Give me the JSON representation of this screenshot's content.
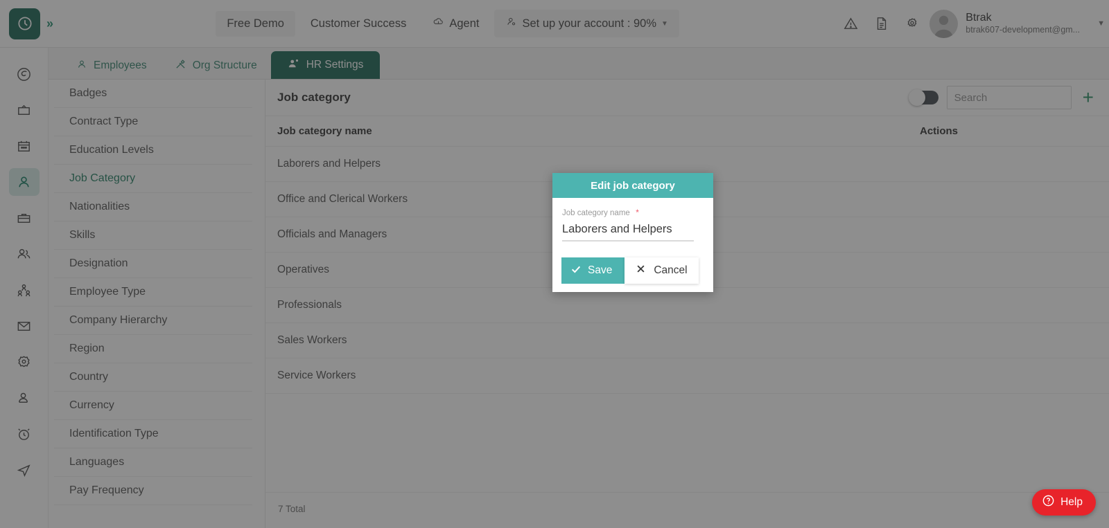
{
  "header": {
    "logo_icon": "clock-logo-icon",
    "expand_icon": "chevron-double-right-icon",
    "nav": [
      {
        "label": "Free Demo",
        "icon": null,
        "boxed": true
      },
      {
        "label": "Customer Success",
        "icon": null,
        "boxed": false
      },
      {
        "label": "Agent",
        "icon": "cloud-icon",
        "boxed": false
      },
      {
        "label": "Set up your account : 90%",
        "icon": "account-setup-icon",
        "boxed": true,
        "caret": true
      }
    ],
    "icons": [
      "warning-triangle-icon",
      "document-icon",
      "gear-icon"
    ],
    "user": {
      "name": "Btrak",
      "email": "btrak607-development@gm...",
      "avatar_icon": "avatar-icon",
      "caret": "chevron-down-icon"
    }
  },
  "rail": {
    "items": [
      {
        "name": "dashboard",
        "icon": "spiral-icon",
        "active": false
      },
      {
        "name": "projects",
        "icon": "tv-icon",
        "active": false
      },
      {
        "name": "calendar",
        "icon": "calendar-icon",
        "active": false
      },
      {
        "name": "employees",
        "icon": "person-icon",
        "active": true
      },
      {
        "name": "briefcase",
        "icon": "briefcase-icon",
        "active": false
      },
      {
        "name": "teams",
        "icon": "people-icon",
        "active": false
      },
      {
        "name": "org-chart",
        "icon": "org-chart-icon",
        "active": false
      },
      {
        "name": "mail",
        "icon": "envelope-icon",
        "active": false
      },
      {
        "name": "settings",
        "icon": "gear-flower-icon",
        "active": false
      },
      {
        "name": "profile",
        "icon": "user-badge-icon",
        "active": false
      },
      {
        "name": "time",
        "icon": "alarm-clock-icon",
        "active": false
      },
      {
        "name": "send",
        "icon": "paper-plane-icon",
        "active": false
      }
    ]
  },
  "tabs": [
    {
      "label": "Employees",
      "icon": "person-icon",
      "active": false
    },
    {
      "label": "Org Structure",
      "icon": "tools-icon",
      "active": false
    },
    {
      "label": "HR Settings",
      "icon": "people-gear-icon",
      "active": true
    }
  ],
  "settings_list": {
    "items": [
      {
        "label": "Badges",
        "active": false
      },
      {
        "label": "Contract Type",
        "active": false
      },
      {
        "label": "Education Levels",
        "active": false
      },
      {
        "label": "Job Category",
        "active": true
      },
      {
        "label": "Nationalities",
        "active": false
      },
      {
        "label": "Skills",
        "active": false
      },
      {
        "label": "Designation",
        "active": false
      },
      {
        "label": "Employee Type",
        "active": false
      },
      {
        "label": "Company Hierarchy",
        "active": false
      },
      {
        "label": "Region",
        "active": false
      },
      {
        "label": "Country",
        "active": false
      },
      {
        "label": "Currency",
        "active": false
      },
      {
        "label": "Identification Type",
        "active": false
      },
      {
        "label": "Languages",
        "active": false
      },
      {
        "label": "Pay Frequency",
        "active": false
      }
    ]
  },
  "content": {
    "title": "Job category",
    "toggle": {
      "name": "show-archived-toggle",
      "state": "off"
    },
    "search": {
      "placeholder": "Search",
      "value": ""
    },
    "add_button": "+",
    "columns": [
      "Job category name",
      "Actions"
    ],
    "rows": [
      {
        "name": "Laborers and Helpers"
      },
      {
        "name": "Office and Clerical Workers"
      },
      {
        "name": "Officials and Managers"
      },
      {
        "name": "Operatives"
      },
      {
        "name": "Professionals"
      },
      {
        "name": "Sales Workers"
      },
      {
        "name": "Service Workers"
      }
    ],
    "row_actions": {
      "edit_icon": "edit-pencil-icon",
      "archive_icon": "archive-icon"
    },
    "footer_total": "7 Total"
  },
  "modal": {
    "title": "Edit job category",
    "field_label": "Job category name",
    "required_mark": "*",
    "field_value": "Laborers and Helpers",
    "save_label": "Save",
    "cancel_label": "Cancel",
    "save_icon": "check-icon",
    "cancel_icon": "x-icon"
  },
  "help": {
    "label": "Help",
    "icon": "question-circle-icon"
  },
  "colors": {
    "brand_dark_teal": "#13604f",
    "accent_teal": "#4db4b0",
    "link_green": "#1b7a5e",
    "help_red": "#e8232a",
    "required_red": "#ef5b6b"
  }
}
